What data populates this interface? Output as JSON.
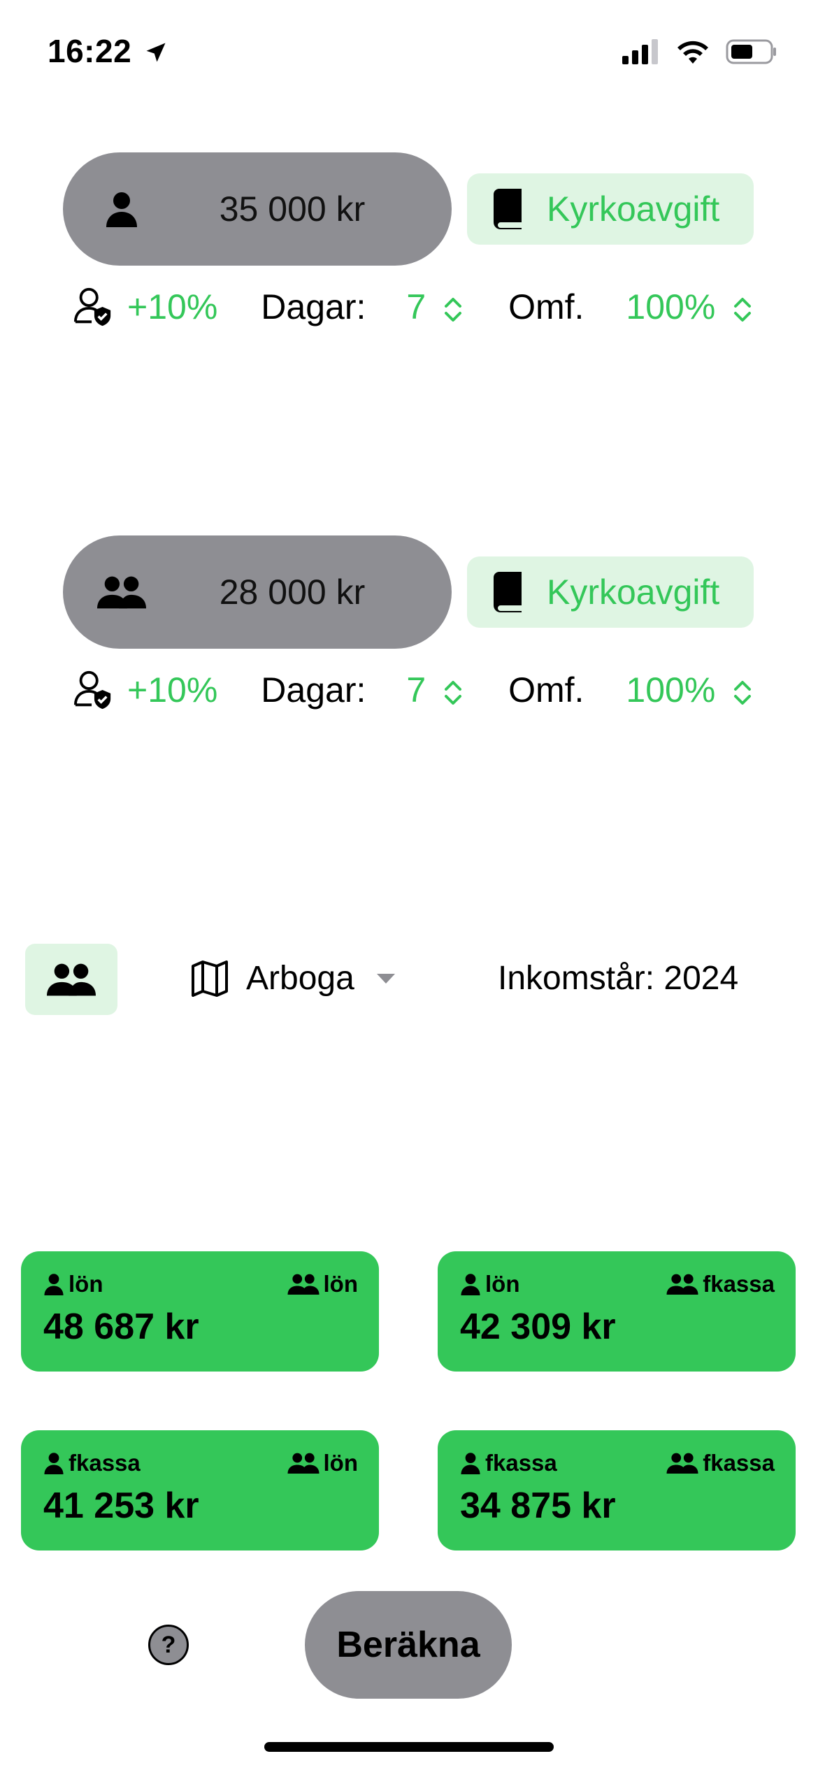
{
  "status_bar": {
    "time": "16:22"
  },
  "person1": {
    "salary": "35 000 kr",
    "church_fee_label": "Kyrkoavgift",
    "bonus": "+10%",
    "days_label": "Dagar:",
    "days_value": "7",
    "extent_label": "Omf.",
    "extent_value": "100%"
  },
  "person2": {
    "salary": "28 000 kr",
    "church_fee_label": "Kyrkoavgift",
    "bonus": "+10%",
    "days_label": "Dagar:",
    "days_value": "7",
    "extent_label": "Omf.",
    "extent_value": "100%"
  },
  "settings": {
    "municipality": "Arboga",
    "income_year": "Inkomstår: 2024"
  },
  "results": [
    {
      "left_tag": "lön",
      "right_tag": "lön",
      "value": "48 687 kr"
    },
    {
      "left_tag": "lön",
      "right_tag": "fkassa",
      "value": "42 309 kr"
    },
    {
      "left_tag": "fkassa",
      "right_tag": "lön",
      "value": "41 253 kr"
    },
    {
      "left_tag": "fkassa",
      "right_tag": "fkassa",
      "value": "34 875 kr"
    }
  ],
  "actions": {
    "help": "?",
    "calculate": "Beräkna"
  },
  "colors": {
    "accent": "#34c759",
    "accent_light": "#dff5e3",
    "pill_gray": "#8e8e93"
  },
  "icons": [
    "location-arrow-icon",
    "signal-icon",
    "wifi-icon",
    "battery-icon",
    "person-icon",
    "people-icon",
    "book-icon",
    "person-check-icon",
    "chevron-updown-icon",
    "map-icon",
    "caret-down-icon"
  ]
}
